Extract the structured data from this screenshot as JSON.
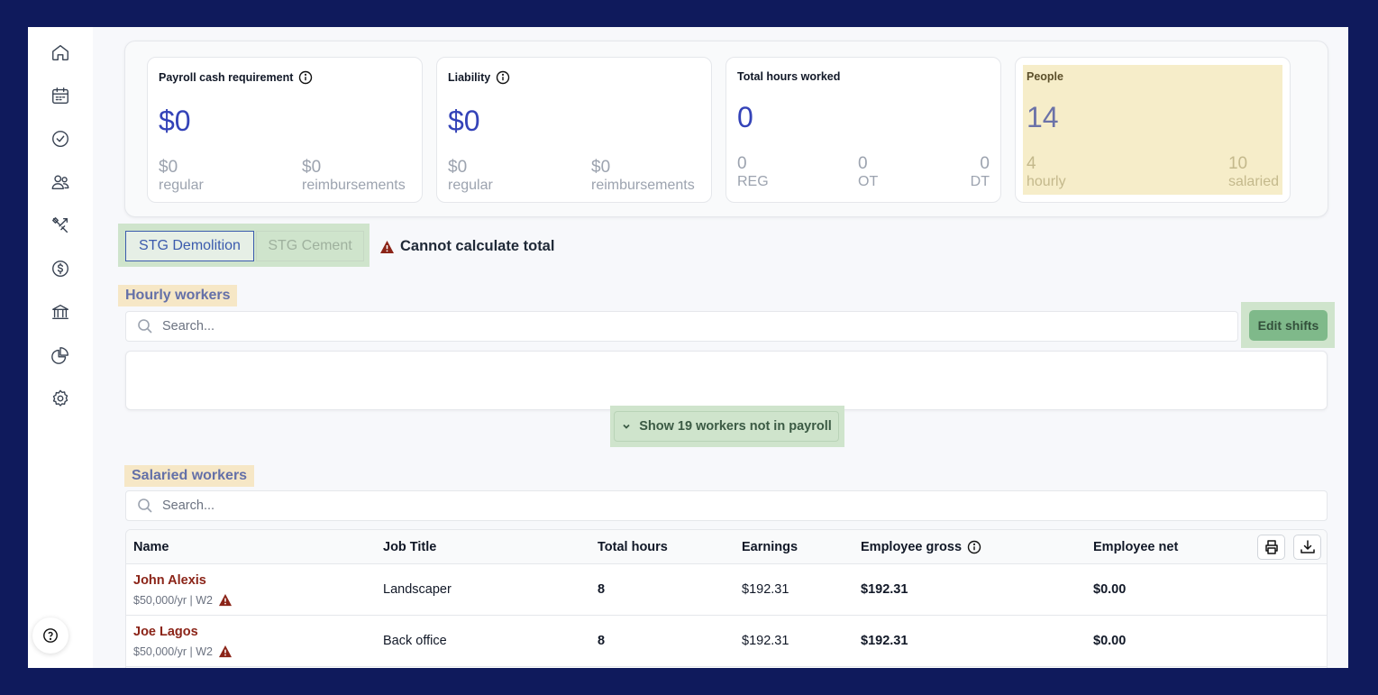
{
  "sidebar": {
    "items": [
      {
        "icon": "home-icon"
      },
      {
        "icon": "calendar-icon"
      },
      {
        "icon": "check-circle-icon"
      },
      {
        "icon": "users-icon"
      },
      {
        "icon": "tools-icon"
      },
      {
        "icon": "dollar-icon"
      },
      {
        "icon": "bank-icon"
      },
      {
        "icon": "pie-chart-icon"
      },
      {
        "icon": "gear-icon"
      }
    ],
    "help_icon": "help-icon"
  },
  "summary": {
    "payroll": {
      "title": "Payroll cash requirement",
      "amount": "$0",
      "regular_value": "$0",
      "regular_label": "regular",
      "reimb_value": "$0",
      "reimb_label": "reimbursements"
    },
    "liability": {
      "title": "Liability",
      "amount": "$0",
      "regular_value": "$0",
      "regular_label": "regular",
      "reimb_value": "$0",
      "reimb_label": "reimbursements"
    },
    "hours": {
      "title": "Total hours worked",
      "amount": "0",
      "reg_value": "0",
      "reg_label": "REG",
      "ot_value": "0",
      "ot_label": "OT",
      "dt_value": "0",
      "dt_label": "DT"
    },
    "people": {
      "title": "People",
      "amount": "14",
      "hourly_value": "4",
      "hourly_label": "hourly",
      "salaried_value": "10",
      "salaried_label": "salaried"
    }
  },
  "tabs": {
    "active": "STG Demolition",
    "inactive": "STG Cement"
  },
  "warning": "Cannot calculate total",
  "hourly": {
    "label": "Hourly workers",
    "search_placeholder": "Search...",
    "edit_button": "Edit shifts",
    "show_button": "Show 19 workers not in payroll"
  },
  "salaried": {
    "label": "Salaried workers",
    "search_placeholder": "Search...",
    "columns": {
      "name": "Name",
      "job": "Job Title",
      "hours": "Total hours",
      "earnings": "Earnings",
      "gross": "Employee gross",
      "net": "Employee net"
    },
    "rows": [
      {
        "name": "John Alexis",
        "meta": "$50,000/yr | W2",
        "job": "Landscaper",
        "hours": "8",
        "earnings": "$192.31",
        "gross": "$192.31",
        "net": "$0.00"
      },
      {
        "name": "Joe Lagos",
        "meta": "$50,000/yr | W2",
        "job": "Back office",
        "hours": "8",
        "earnings": "$192.31",
        "gross": "$192.31",
        "net": "$0.00"
      }
    ]
  },
  "colors": {
    "accent": "#3443b8",
    "warning": "#8b2418",
    "highlight_green": "#cfe4cc",
    "highlight_yellow": "#f6edc9"
  }
}
